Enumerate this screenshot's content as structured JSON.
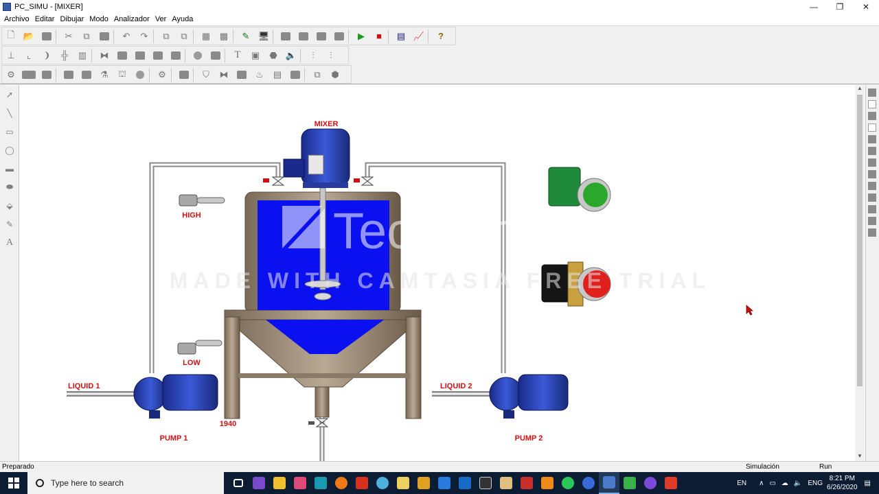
{
  "window": {
    "title": "PC_SIMU - [MIXER]",
    "controls": [
      "—",
      "❐",
      "✕"
    ]
  },
  "menu": [
    "Archivo",
    "Editar",
    "Dibujar",
    "Modo",
    "Analizador",
    "Ver",
    "Ayuda"
  ],
  "diagram": {
    "mixer_label": "MIXER",
    "high_label": "HIGH",
    "low_label": "LOW",
    "liquid1_label": "LIQUID 1",
    "liquid2_label": "LIQUID 2",
    "pump1_label": "PUMP 1",
    "pump2_label": "PUMP 2",
    "level_value": "1940",
    "start_button_color": "#2ba82b",
    "stop_button_color": "#e0201c",
    "tank_liquid_color": "#0a10f0"
  },
  "watermark": {
    "brand": "TechSmith",
    "notice": "MADE WITH CAMTASIA FREE TRIAL"
  },
  "statusbar": {
    "left": "Preparado",
    "mode": "Simulación",
    "state": "Run"
  },
  "taskbar": {
    "search_placeholder": "Type here to search",
    "language": "EN",
    "keyboard": "ENG",
    "time": "8:21 PM",
    "date": "6/26/2020"
  }
}
